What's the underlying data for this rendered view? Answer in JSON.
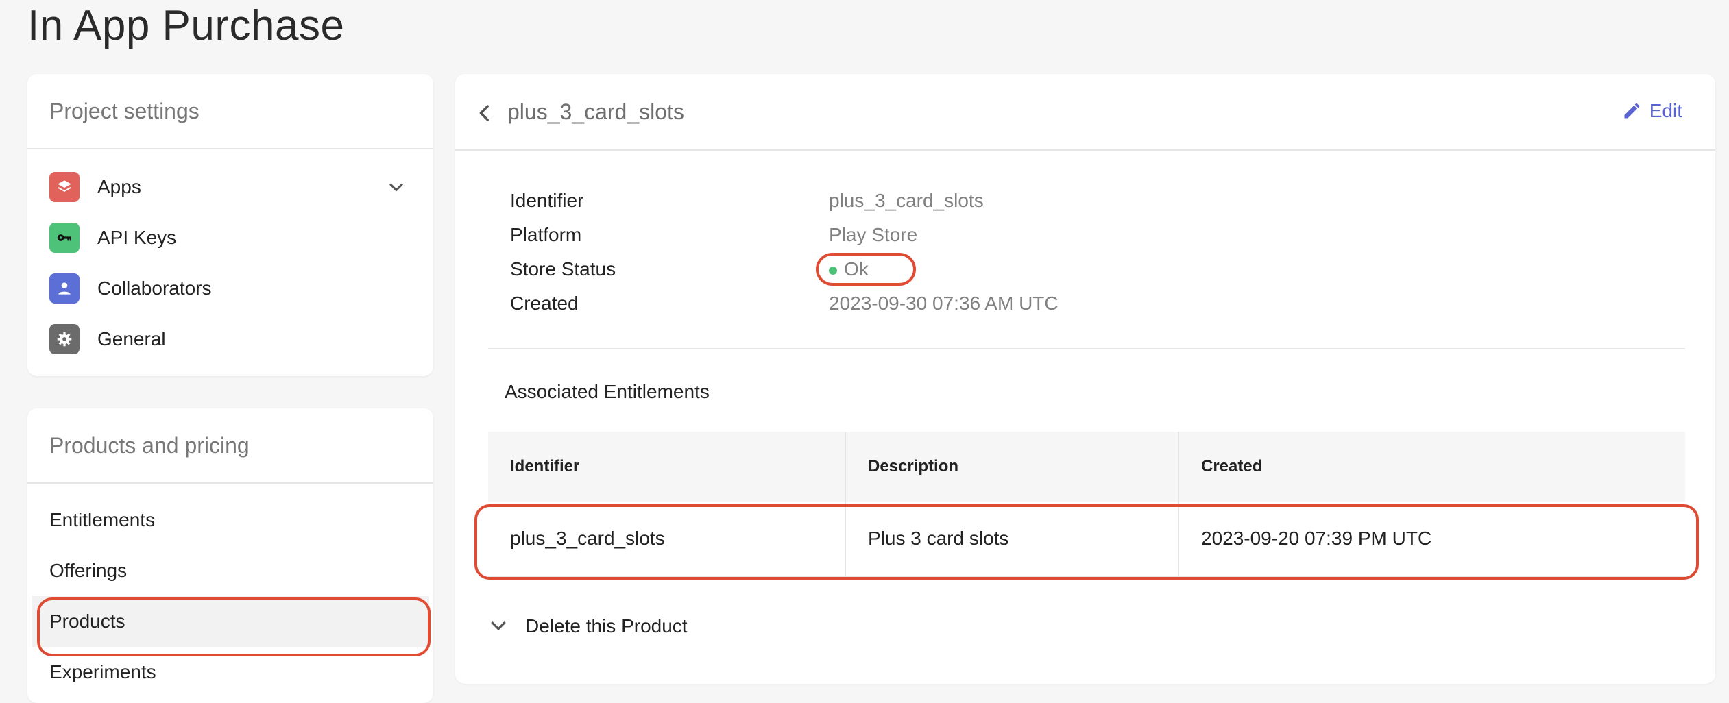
{
  "page": {
    "title": "In App Purchase"
  },
  "project_settings": {
    "header": "Project settings",
    "items": [
      {
        "label": "Apps",
        "icon": "layers-icon",
        "color": "#e0625a"
      },
      {
        "label": "API Keys",
        "icon": "key-icon",
        "color": "#4fc27a"
      },
      {
        "label": "Collaborators",
        "icon": "person-icon",
        "color": "#5b6fd6"
      },
      {
        "label": "General",
        "icon": "gear-icon",
        "color": "#6b6b6b"
      }
    ]
  },
  "products_pricing": {
    "header": "Products and pricing",
    "items": [
      {
        "label": "Entitlements"
      },
      {
        "label": "Offerings"
      },
      {
        "label": "Products",
        "selected": true
      },
      {
        "label": "Experiments"
      }
    ]
  },
  "detail": {
    "title": "plus_3_card_slots",
    "edit_label": "Edit",
    "fields": [
      {
        "label": "Identifier",
        "value": "plus_3_card_slots"
      },
      {
        "label": "Platform",
        "value": "Play Store"
      },
      {
        "label": "Store Status",
        "value": "Ok",
        "status_color": "#4fc27a"
      },
      {
        "label": "Created",
        "value": "2023-09-30 07:36 AM UTC"
      }
    ],
    "entitlements": {
      "title": "Associated Entitlements",
      "columns": [
        "Identifier",
        "Description",
        "Created"
      ],
      "rows": [
        [
          "plus_3_card_slots",
          "Plus 3 card slots",
          "2023-09-20 07:39 PM UTC"
        ]
      ]
    },
    "delete_label": "Delete this Product"
  },
  "colors": {
    "accent": "#5b63d3",
    "highlight": "#e04b34",
    "ok": "#4fc27a"
  }
}
